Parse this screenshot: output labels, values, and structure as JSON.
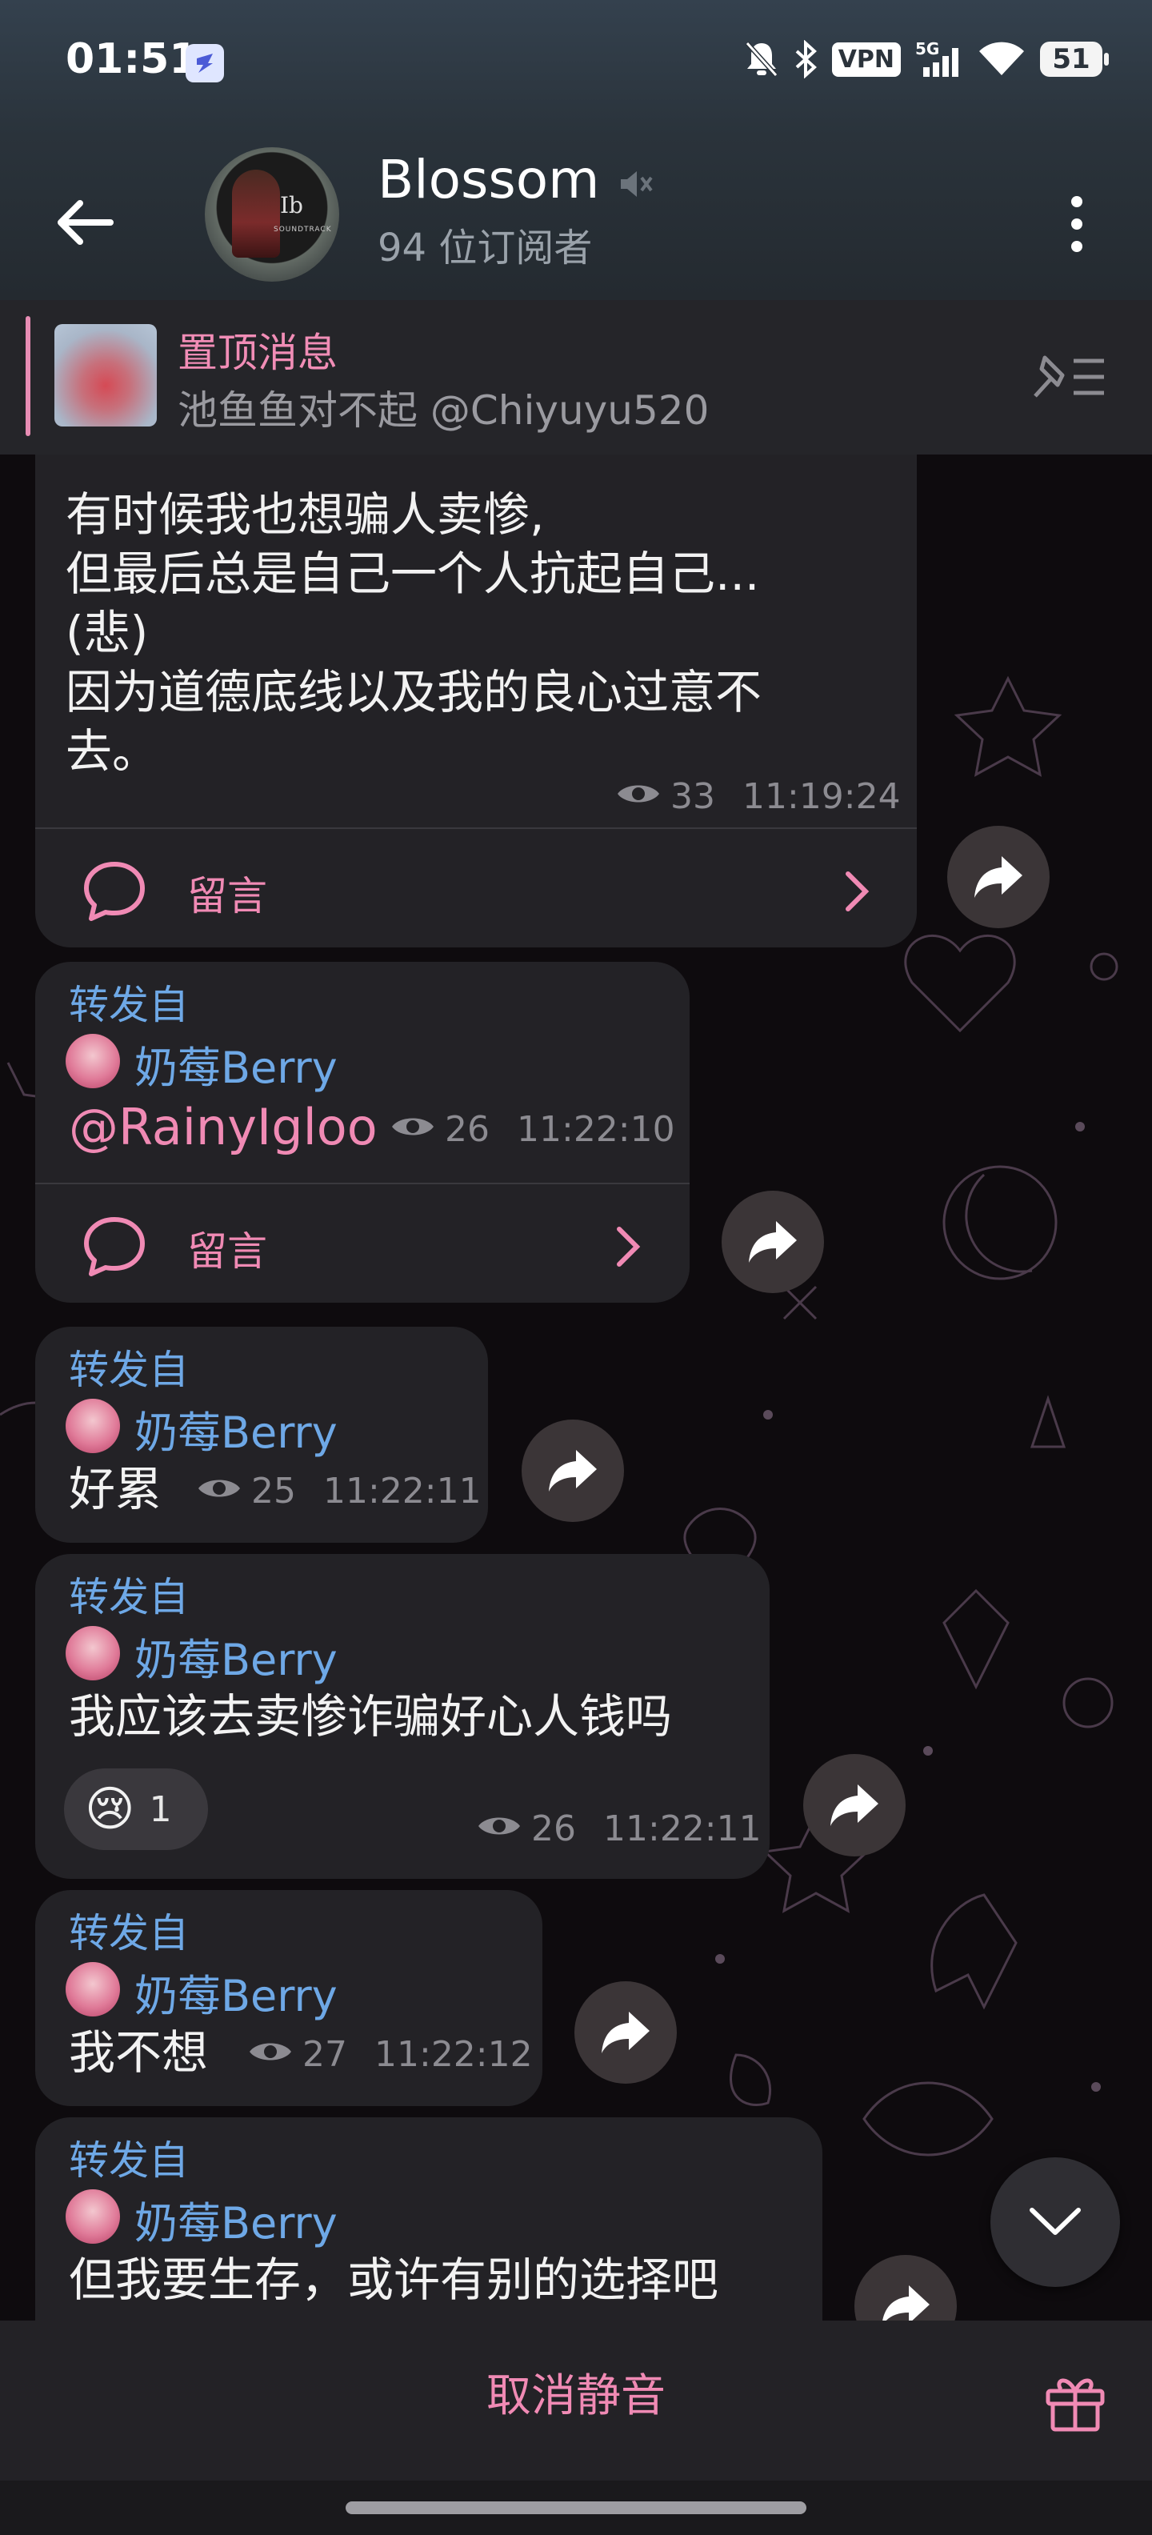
{
  "status_bar": {
    "time": "01:51",
    "vpn_label": "VPN",
    "network": "5G",
    "battery": "51"
  },
  "header": {
    "title": "Blossom",
    "subtitle": "94 位订阅者",
    "avatar_text": "Ib",
    "avatar_subtext": "SOUNDTRACK"
  },
  "pinned": {
    "label": "置顶消息",
    "text": "池鱼鱼对不起 @Chiyuyu520"
  },
  "messages": [
    {
      "text": "有时候我也想骗人卖惨,\n但最后总是自己一个人抗起自己...\n(悲)\n因为道德底线以及我的良心过意不\n去。",
      "views": "33",
      "time": "11:19:24",
      "comment_label": "留言"
    },
    {
      "forwarded_label": "转发自",
      "author": "奶莓Berry",
      "text": "@RainyIgloo",
      "views": "26",
      "time": "11:22:10",
      "comment_label": "留言"
    },
    {
      "forwarded_label": "转发自",
      "author": "奶莓Berry",
      "text": "好累",
      "views": "25",
      "time": "11:22:11"
    },
    {
      "forwarded_label": "转发自",
      "author": "奶莓Berry",
      "text": "我应该去卖惨诈骗好心人钱吗",
      "reaction_emoji": "😢",
      "reaction_count": "1",
      "views": "26",
      "time": "11:22:11"
    },
    {
      "forwarded_label": "转发自",
      "author": "奶莓Berry",
      "text": "我不想",
      "views": "27",
      "time": "11:22:12"
    },
    {
      "forwarded_label": "转发自",
      "author": "奶莓Berry",
      "text": "但我要生存，或许有别的选择吧"
    }
  ],
  "bottom": {
    "unmute_label": "取消静音"
  },
  "colors": {
    "accent_pink": "#f08ab4",
    "link_blue": "#6ea8e6",
    "bubble": "#232226",
    "background": "#0e0b0e"
  },
  "icons": [
    "back-arrow-icon",
    "mute-icon",
    "more-vert-icon",
    "pin-list-icon",
    "comment-icon",
    "chevron-right-icon",
    "share-icon",
    "eye-icon",
    "scroll-down-icon",
    "gift-icon"
  ]
}
